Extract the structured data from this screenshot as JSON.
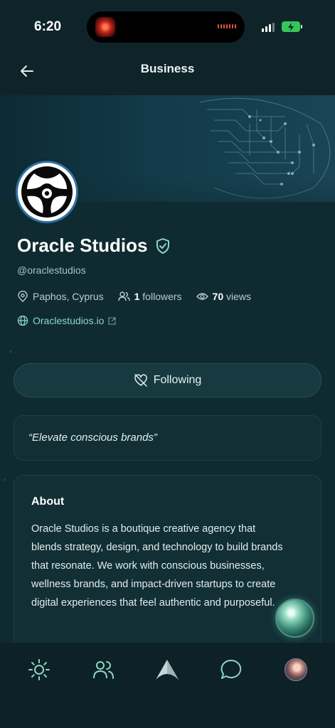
{
  "status_bar": {
    "time": "6:20"
  },
  "header": {
    "title": "Business"
  },
  "profile": {
    "name": "Oracle Studios",
    "handle": "@oraclestudios",
    "location": "Paphos, Cyprus",
    "followers_count": "1",
    "followers_label": "followers",
    "views_count": "70",
    "views_label": "views",
    "website": "Oraclestudios.io"
  },
  "actions": {
    "following_label": "Following"
  },
  "tagline": "“Elevate conscious brands”",
  "about": {
    "title": "About",
    "text": "Oracle Studios is a boutique creative agency that blends strategy, design, and technology to build brands that resonate. We work with conscious businesses, wellness brands, and impact-driven startups to create digital experiences that feel authentic and purposeful."
  },
  "nav": {
    "items": [
      {
        "icon": "sun-icon"
      },
      {
        "icon": "people-icon"
      },
      {
        "icon": "triangle-logo-icon"
      },
      {
        "icon": "chat-bubble-icon"
      },
      {
        "icon": "user-avatar"
      }
    ]
  },
  "colors": {
    "background": "#0f2a30",
    "card": "#112f35",
    "accent_link": "#8fd4c7",
    "verified": "#8fd4c7"
  }
}
